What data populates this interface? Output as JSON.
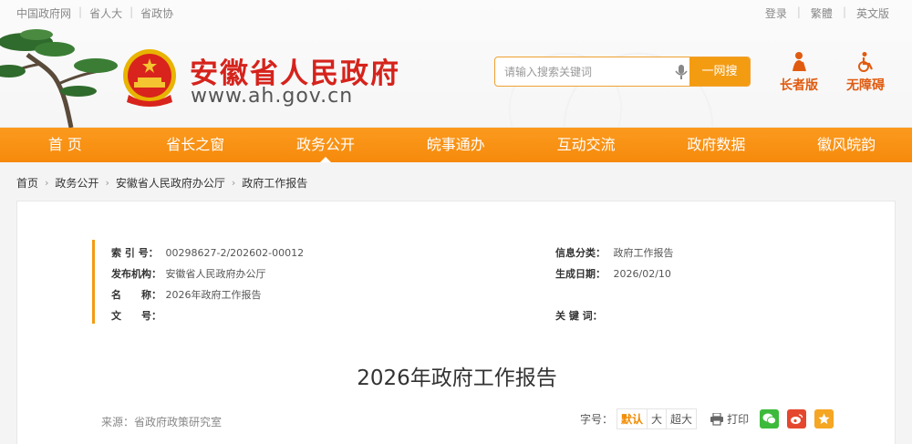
{
  "top": {
    "links": [
      "中国政府网",
      "省人大",
      "省政协"
    ],
    "right_links": [
      "登录",
      "繁體",
      "英文版"
    ]
  },
  "site": {
    "title": "安徽省人民政府",
    "url": "www.ah.gov.cn"
  },
  "search": {
    "placeholder": "请输入搜索关键词",
    "button": "一网搜"
  },
  "modes": {
    "elder": "长者版",
    "accessible": "无障碍"
  },
  "nav": [
    "首 页",
    "省长之窗",
    "政务公开",
    "皖事通办",
    "互动交流",
    "政府数据",
    "徽风皖韵"
  ],
  "nav_active_index": 2,
  "breadcrumb": [
    "首页",
    "政务公开",
    "安徽省人民政府办公厅",
    "政府工作报告"
  ],
  "meta": {
    "index_label": "索 引 号：",
    "index_value": "00298627-2/202602-00012",
    "category_label": "信息分类：",
    "category_value": "政府工作报告",
    "org_label": "发布机构：",
    "org_value": "安徽省人民政府办公厅",
    "date_label": "生成日期：",
    "date_value": "2026/02/10",
    "name_label": "名　　称：",
    "name_value": "2026年政府工作报告",
    "docno_label": "文　　号：",
    "docno_value": "",
    "keywords_label": "关 键 词：",
    "keywords_value": ""
  },
  "document": {
    "title": "2026年政府工作报告",
    "source": "来源：省政府政策研究室"
  },
  "tools": {
    "font_label": "字号：",
    "font_sizes": [
      "默认",
      "大",
      "超大"
    ],
    "print": "打印"
  },
  "colors": {
    "brand_red": "#d5231c",
    "nav_orange": "#f68a0c",
    "accent": "#f39c12"
  }
}
